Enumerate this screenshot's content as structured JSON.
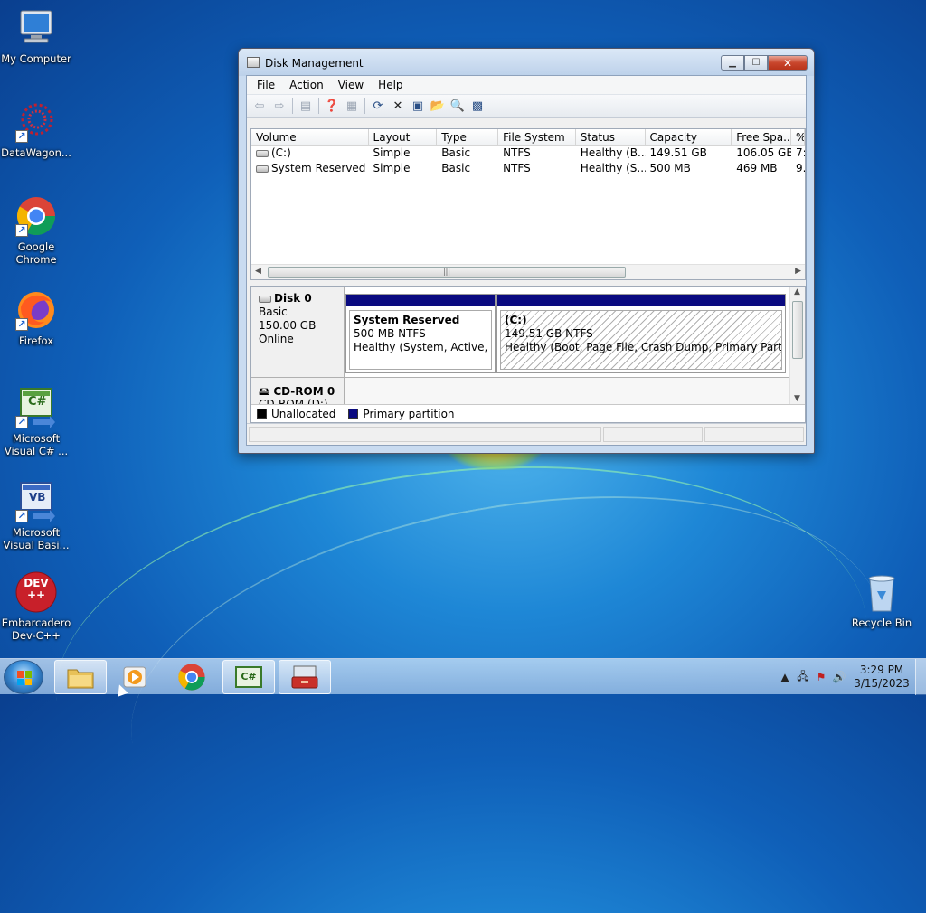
{
  "desktop": {
    "icons": [
      {
        "label": "My Computer"
      },
      {
        "label": "DataWagon..."
      },
      {
        "label": "Google Chrome"
      },
      {
        "label": "Firefox"
      },
      {
        "label": "Microsoft Visual C# ..."
      },
      {
        "label": "Microsoft Visual Basi..."
      },
      {
        "label": "Embarcadero Dev-C++"
      },
      {
        "label": "Recycle Bin"
      }
    ],
    "csharp_glyph": "C#",
    "vb_glyph": "VB",
    "devcpp_glyph": "DEV\n++"
  },
  "window": {
    "title": "Disk Management",
    "menu": [
      "File",
      "Action",
      "View",
      "Help"
    ],
    "volume_table": {
      "columns": [
        "Volume",
        "Layout",
        "Type",
        "File System",
        "Status",
        "Capacity",
        "Free Spa...",
        "%"
      ],
      "rows": [
        [
          "(C:)",
          "Simple",
          "Basic",
          "NTFS",
          "Healthy (B...",
          "149.51 GB",
          "106.05 GB",
          "7:"
        ],
        [
          "System Reserved",
          "Simple",
          "Basic",
          "NTFS",
          "Healthy (S...",
          "500 MB",
          "469 MB",
          "9."
        ]
      ]
    },
    "disk0": {
      "name": "Disk 0",
      "type": "Basic",
      "size": "150.00 GB",
      "state": "Online",
      "partitions": [
        {
          "title": "System Reserved",
          "size": "500 MB NTFS",
          "status": "Healthy (System, Active, Prin"
        },
        {
          "title": "(C:)",
          "size": "149.51 GB NTFS",
          "status": "Healthy (Boot, Page File, Crash Dump, Primary Partition)"
        }
      ]
    },
    "cdrom": {
      "name": "CD-ROM 0",
      "sub": "CD-ROM (D:)"
    },
    "legend": [
      {
        "label": "Unallocated",
        "color": "#000000"
      },
      {
        "label": "Primary partition",
        "color": "#0a0a80"
      }
    ]
  },
  "taskbar": {
    "time": "3:29 PM",
    "date": "3/15/2023",
    "csharp_glyph": "C#"
  }
}
